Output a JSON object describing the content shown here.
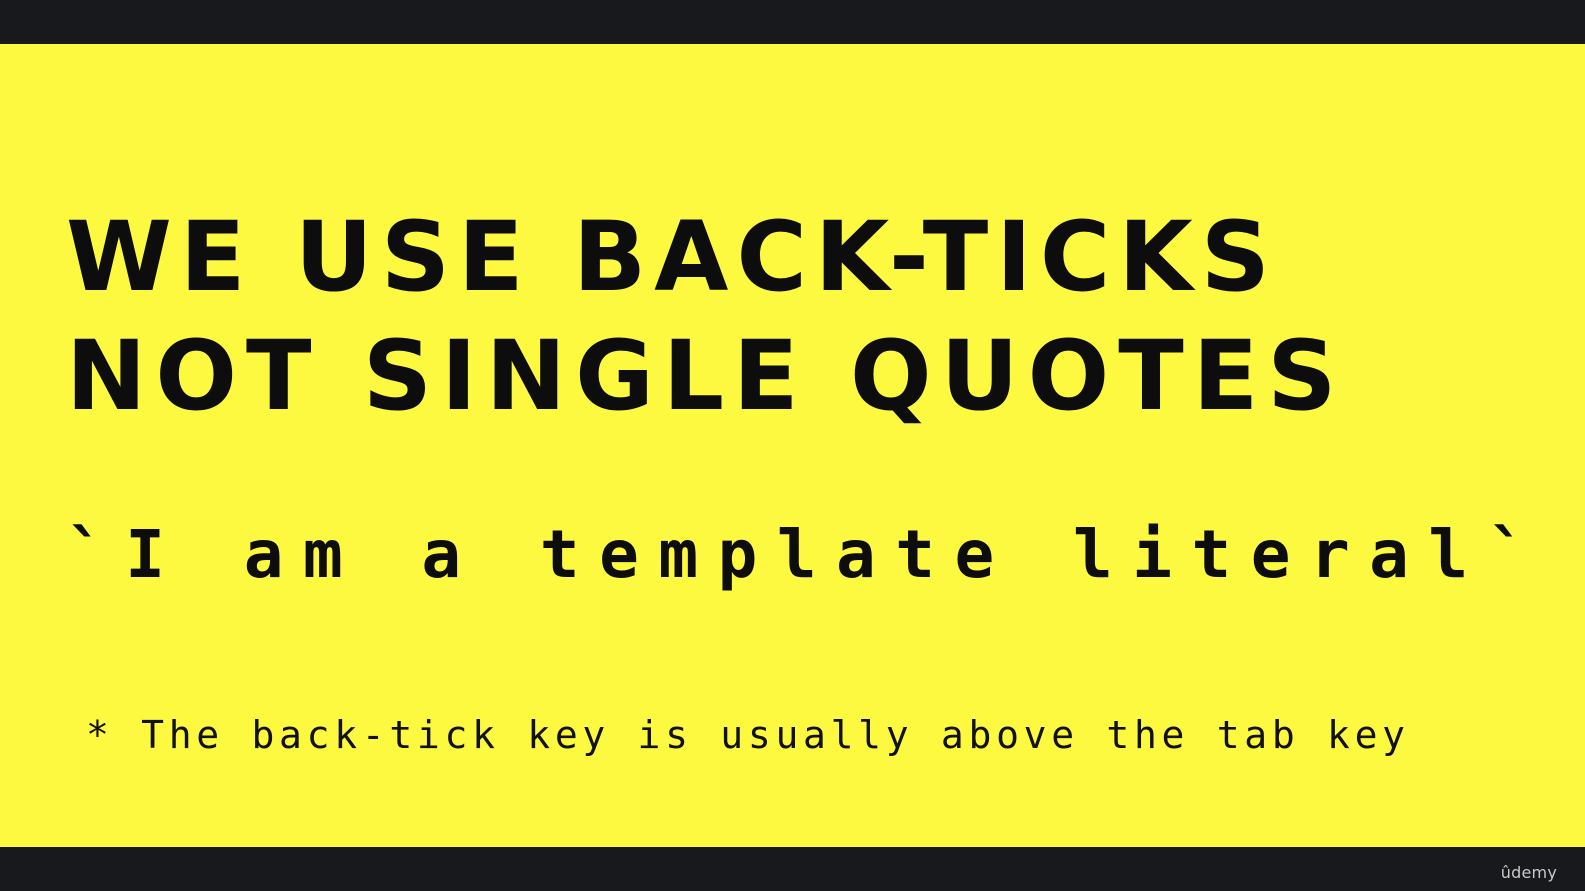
{
  "slide": {
    "headline_line1": "WE USE BACK-TICKS",
    "headline_line2": "NOT SINGLE QUOTES",
    "code_example": "`I am a template literal`",
    "footnote": "* The back-tick key is usually above the tab key",
    "background_color": "#fdf840",
    "text_color": "#0d0d0d"
  },
  "player": {
    "brand": "ûdemy"
  }
}
